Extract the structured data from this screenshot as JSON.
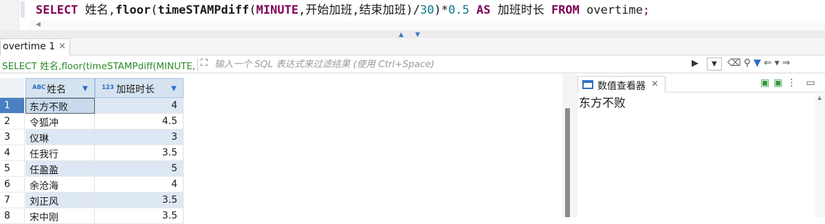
{
  "editor": {
    "sql_tokens": [
      {
        "t": "SELECT",
        "c": "kw"
      },
      {
        "t": " 姓名,",
        "c": "plain"
      },
      {
        "t": "floor",
        "c": "fn"
      },
      {
        "t": "(",
        "c": "plain"
      },
      {
        "t": "timeSTAMPdiff",
        "c": "fn"
      },
      {
        "t": "(",
        "c": "plain"
      },
      {
        "t": "MINUTE",
        "c": "kw2"
      },
      {
        "t": ",开始加班,结束加班)/",
        "c": "plain"
      },
      {
        "t": "30",
        "c": "num"
      },
      {
        "t": ")*",
        "c": "plain"
      },
      {
        "t": "0.5",
        "c": "num"
      },
      {
        "t": " ",
        "c": "plain"
      },
      {
        "t": "AS",
        "c": "kw"
      },
      {
        "t": " 加班时长 ",
        "c": "plain"
      },
      {
        "t": "FROM",
        "c": "kw"
      },
      {
        "t": " overtime",
        "c": "plain"
      },
      {
        "t": ";",
        "c": "semi"
      }
    ]
  },
  "result_tab": {
    "label": "overtime 1",
    "close": "×"
  },
  "filter": {
    "query_text": "SELECT 姓名,floor(timeSTAMPdiff(MINUTE,",
    "placeholder": "输入一个 SQL 表达式来过滤结果 (使用 Ctrl+Space)"
  },
  "grid": {
    "columns": [
      {
        "type_badge": "ABC",
        "label": "姓名"
      },
      {
        "type_badge": "123",
        "label": "加班时长"
      }
    ],
    "rows": [
      {
        "n": "1",
        "name": "东方不败",
        "hours": "4"
      },
      {
        "n": "2",
        "name": "令狐冲",
        "hours": "4.5"
      },
      {
        "n": "3",
        "name": "仪琳",
        "hours": "3"
      },
      {
        "n": "4",
        "name": "任我行",
        "hours": "3.5"
      },
      {
        "n": "5",
        "name": "任盈盈",
        "hours": "5"
      },
      {
        "n": "6",
        "name": "余沧海",
        "hours": "4"
      },
      {
        "n": "7",
        "name": "刘正风",
        "hours": "3.5"
      },
      {
        "n": "8",
        "name": "宋中刚",
        "hours": "3.5"
      }
    ]
  },
  "viewer": {
    "tab_label": "数值查看器",
    "close": "×",
    "value": "东方不败"
  },
  "colors": {
    "selected_row_number": "#4a7fc1",
    "alt_row": "#dde8f4",
    "keyword": "#7f0055",
    "query_text": "#2a8a2a"
  }
}
